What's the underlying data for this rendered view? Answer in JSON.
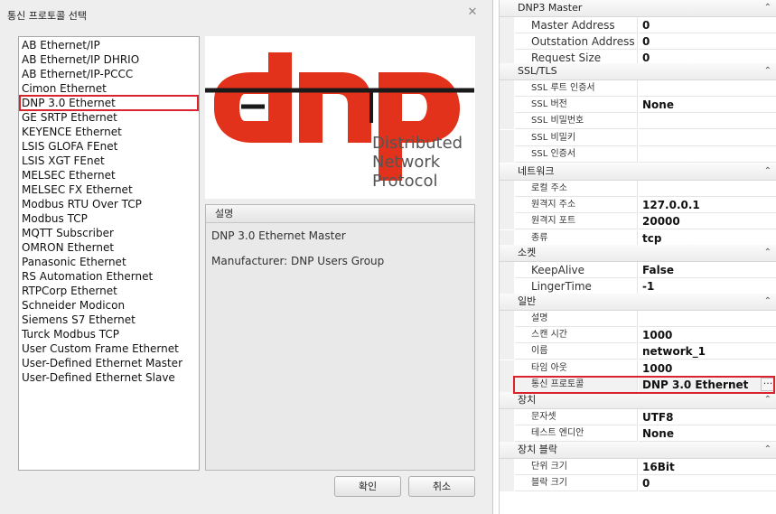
{
  "dialog": {
    "title": "통신 프로토콜 선택",
    "protocols": [
      "AB Ethernet/IP",
      "AB Ethernet/IP DHRIO",
      "AB Ethernet/IP-PCCC",
      "Cimon Ethernet",
      "DNP 3.0 Ethernet",
      "GE SRTP Ethernet",
      "KEYENCE Ethernet",
      "LSIS GLOFA FEnet",
      "LSIS XGT FEnet",
      "MELSEC Ethernet",
      "MELSEC FX Ethernet",
      "Modbus RTU Over TCP",
      "Modbus TCP",
      "MQTT Subscriber",
      "OMRON Ethernet",
      "Panasonic Ethernet",
      "RS Automation Ethernet",
      "RTPCorp Ethernet",
      "Schneider Modicon",
      "Siemens S7 Ethernet",
      "Turck Modbus TCP",
      "User Custom Frame Ethernet",
      "User-Defined Ethernet Master",
      "User-Defined Ethernet Slave"
    ],
    "selected_protocol": "DNP 3.0 Ethernet",
    "logo": {
      "wordmark": "dnp",
      "tagline_1": "Distributed",
      "tagline_2": "Network",
      "tagline_3": "Protocol",
      "color": "#e2321b"
    },
    "description": {
      "header": "설명",
      "line1": "DNP 3.0 Ethernet Master",
      "line2": "Manufacturer: DNP Users Group"
    },
    "ok_label": "확인",
    "cancel_label": "취소"
  },
  "property_grid": {
    "categories": [
      {
        "name": "DNP3 Master",
        "rows": [
          {
            "name": "Master Address",
            "value": "0"
          },
          {
            "name": "Outstation Address",
            "value": "0"
          },
          {
            "name": "Request Size",
            "value": "0"
          }
        ]
      },
      {
        "name": "SSL/TLS",
        "rows": [
          {
            "name": "SSL 루트 인증서",
            "value": ""
          },
          {
            "name": "SSL 버전",
            "value": "None"
          },
          {
            "name": "SSL 비밀번호",
            "value": ""
          },
          {
            "name": "SSL 비밀키",
            "value": ""
          },
          {
            "name": "SSL 인증서",
            "value": ""
          }
        ]
      },
      {
        "name": "네트워크",
        "rows": [
          {
            "name": "로컬 주소",
            "value": ""
          },
          {
            "name": "원격지 주소",
            "value": "127.0.0.1"
          },
          {
            "name": "원격지 포트",
            "value": "20000"
          },
          {
            "name": "종류",
            "value": "tcp"
          }
        ]
      },
      {
        "name": "소켓",
        "rows": [
          {
            "name": "KeepAlive",
            "value": "False"
          },
          {
            "name": "LingerTime",
            "value": "-1"
          }
        ]
      },
      {
        "name": "일반",
        "rows": [
          {
            "name": "설명",
            "value": ""
          },
          {
            "name": "스캔 시간",
            "value": "1000"
          },
          {
            "name": "이름",
            "value": "network_1"
          },
          {
            "name": "타임 아웃",
            "value": "1000"
          },
          {
            "name": "통신 프로토콜",
            "value": "DNP 3.0 Ethernet"
          }
        ]
      },
      {
        "name": "장치",
        "rows": [
          {
            "name": "문자셋",
            "value": "UTF8"
          },
          {
            "name": "테스트 엔디안",
            "value": "None"
          }
        ]
      },
      {
        "name": "장치 블락",
        "rows": [
          {
            "name": "단위 크기",
            "value": "16Bit"
          },
          {
            "name": "블락 크기",
            "value": "0"
          }
        ]
      }
    ],
    "ellipsis_label": "···",
    "collapse_glyph": "^"
  },
  "colors": {
    "highlight_red": "#d9232d",
    "logo_red": "#e2321b"
  }
}
